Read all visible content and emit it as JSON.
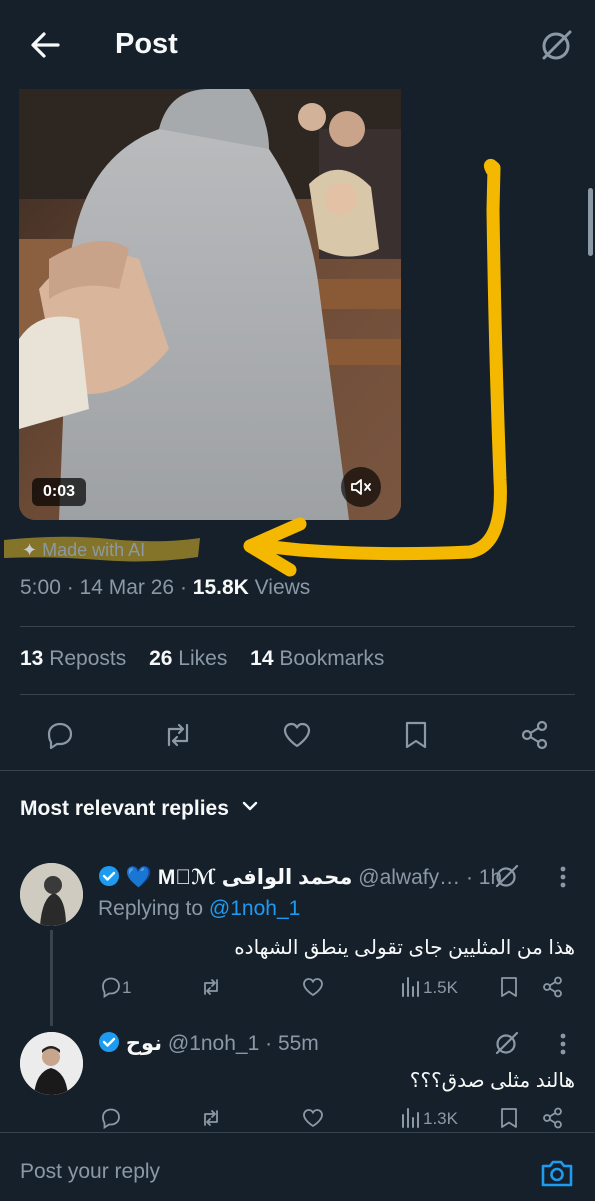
{
  "header": {
    "title": "Post"
  },
  "video": {
    "duration": "0:03"
  },
  "post": {
    "ai_label": "Made with AI",
    "time": "5:00",
    "date": "14 Mar 26",
    "views_count": "15.8K",
    "views_label": "Views",
    "reposts_count": "13",
    "reposts_label": "Reposts",
    "likes_count": "26",
    "likes_label": "Likes",
    "bookmarks_count": "14",
    "bookmarks_label": "Bookmarks"
  },
  "replies_header": {
    "label": "Most relevant replies"
  },
  "replies": [
    {
      "name": "محمد الوافى M🏽ℳ",
      "handle": "@alwafy…",
      "time": "· 1h",
      "replying_label": "Replying to",
      "replying_handle": "@1noh_1",
      "text": "هذا من المثليين جاى تقولى ينطق الشهاده",
      "reply_count": "1",
      "views": "1.5K"
    },
    {
      "name": "نوح",
      "handle": "@1noh_1",
      "time": "· 55m",
      "text": "هالند مثلى صدق؟؟؟",
      "reply_count": "",
      "views": "1.3K"
    }
  ],
  "reply_box": {
    "placeholder": "Post your reply"
  },
  "colors": {
    "accent": "#1d9bf0",
    "background": "#15202b",
    "annotation": "#f5b800",
    "muted": "#8b98a5"
  }
}
